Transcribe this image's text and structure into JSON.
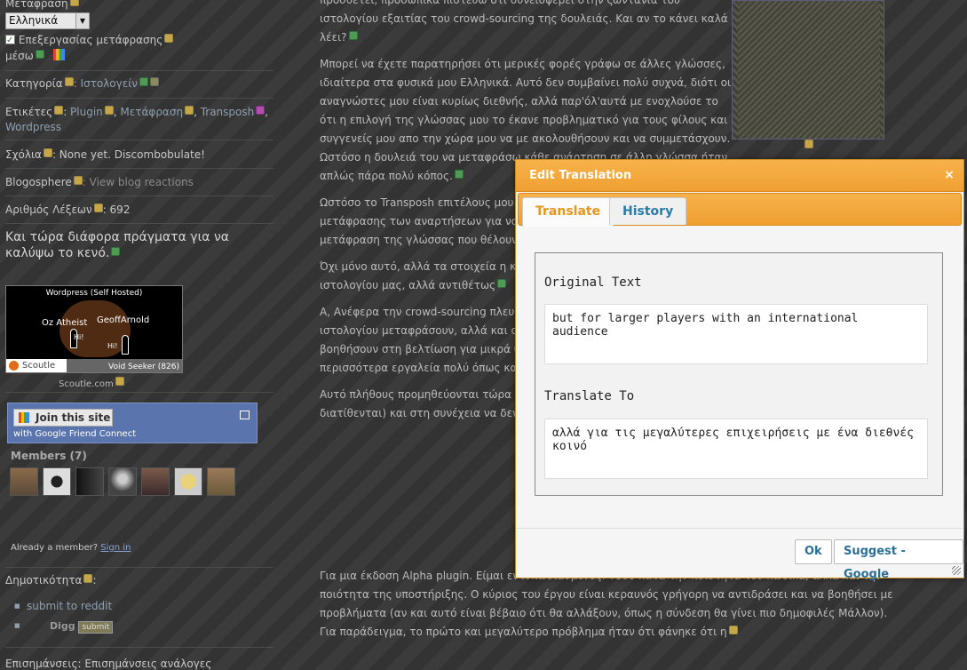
{
  "sidebar": {
    "translation_label": "Μετάφραση",
    "language_select": "Ελληνικά",
    "edit_translation_checkbox": "Επεξεργασίας μετάφρασης",
    "via_label": "μέσω",
    "category_label": "Κατηγορία",
    "category_value": ": Ιστολογείν",
    "tags_label": "Ετικέτες",
    "tags": [
      "Plugin",
      "Μετάφραση",
      "Transposh",
      "Wordpress"
    ],
    "comments_label": "Σχόλια",
    "comments_value": ": None yet. Discombobulate!",
    "blogosphere_label": "Blogosphere",
    "blogosphere_value": ": View blog reactions",
    "word_count_label": "Αριθμός Λέξεων",
    "word_count_value": ": 692",
    "filler_text": "Και τώρα διάφορα πράγματα για να καλύψω το κενό.",
    "scoutle": {
      "title": "Wordpress (Self Hosted)",
      "name1": "Oz Atheist",
      "name2": "GeoffArnold",
      "hi": "Hi!",
      "logo": "Scoutle",
      "seeker": "Void Seeker (826)",
      "caption": "Scoutle.com"
    },
    "gfc": {
      "join_button": "Join this site",
      "subtitle": "with Google Friend Connect"
    },
    "members_title": "Members (7)",
    "already_member": "Already a member?",
    "sign_in": "Sign in",
    "popularity_label": "Δημοτικότητα",
    "submit_reddit": "submit to reddit",
    "digg_label": "Digg",
    "digg_button": "submit",
    "bottom_label": "Επισημάνσεις: Επισημάνσεις ανάλογες"
  },
  "article": {
    "p0": "προσθέτει, προσωπικά πιστεύω ότι συνεισφέρει στην ζωντάνια του ιστολογίου εξαιτίας του crowd-sourcing της δουλειάς. Και αν το κάνει καλά λέει?",
    "p1": "Μπορεί να έχετε παρατηρήσει ότι μερικές φορές γράφω σε άλλες γλώσσες, ιδιαίτερα στα φυσικά μου Ελληνικά. Αυτό δεν συμβαίνει πολύ συχνά, διότι οι αναγνώστες μου είναι κυρίως διεθνής, αλλά παρ'όλ'αυτά με ενοχλούσε το ότι η επιλογή της γλώσσας μου το έκανε προβληματικό για τους φίλους και συγγενείς μου απο την χώρα μου να με ακολουθήσουν και να συμμετάσχουν. Ωστόσο η δουλειά του να μεταφράσω κάθε ανάρτηση σε άλλη γλώσσα ήταν απλώς πάρα πολύ κόπος.",
    "p2": "Ωστόσο το Transposh επιτέλους μου επιτρέπει να κάνω το έργο της μετάφρασης των αναρτήσεων για να μεταφράσει το κείμενο, διαλέγοντας τη μετάφραση της γλώσσας που θέλουν χωρίς να χρειάζεται να περάσει μέσα",
    "p3": "Όχι μόνο αυτό, αλλά τα στοιχεία η κεφαλίδα, αφότου διορθώθουν του ιστολογίου μας, αλλά αντιθέτως",
    "p4": "Α, Ανέφερα την crowd-sourcing πλευρά ευκαιρία στον συγγραφέα του ιστολογίου μεταφράσουν, αλλά και στους αναγνώστες μπορούν να βοηθήσουν στη βελτίωση για μικρά ψάρια όπως εγώ, αλλά προσφέρει πολύ περισσότερα εργαλεία πολύ όπως και κάθε wiki, κάποιος",
    "p5": "Αυτό πλήθους προμηθεύονται τώρα site, μπορείτε να βοηθήσετε να με διατίθενται) και στη συνέχεια να δεν είναι και τόσο κακό."
  },
  "bottom_article": {
    "p6": "Για μια έκδοση Alpha plugin. Είμαι εντυπωσιασμένος. Τόσο κατά την ποιότητα του κώδικα, αλλά και την ποιότητα της υποστήριξης. Ο κύριος του έργου είναι κεραυνός γρήγορη να αντιδράσει και να βοηθήσει με προβλήματα (αν και αυτό είναι βέβαιο ότι θα αλλάξουν, όπως η σύνδεση θα γίνει πιο δημοφιλές Μάλλον). Για παράδειγμα, το πρώτο και μεγαλύτερο πρόβλημα ήταν ότι φάνηκε ότι η"
  },
  "dialog": {
    "title": "Edit Translation",
    "close": "×",
    "tabs": [
      {
        "label": "Translate",
        "active": true
      },
      {
        "label": "History",
        "active": false
      }
    ],
    "original_label": "Original Text",
    "original_value": "but for larger players with an international audience",
    "translate_label": "Translate To",
    "translate_value": "αλλά για τις μεγαλύτερες επιχειρήσεις με ένα διεθνές κοινό",
    "ok_button": "Ok",
    "suggest_button": "Suggest - Google"
  },
  "colors": {
    "accent": "#f0a032",
    "link": "#2a7ca8",
    "background": "#383838"
  }
}
